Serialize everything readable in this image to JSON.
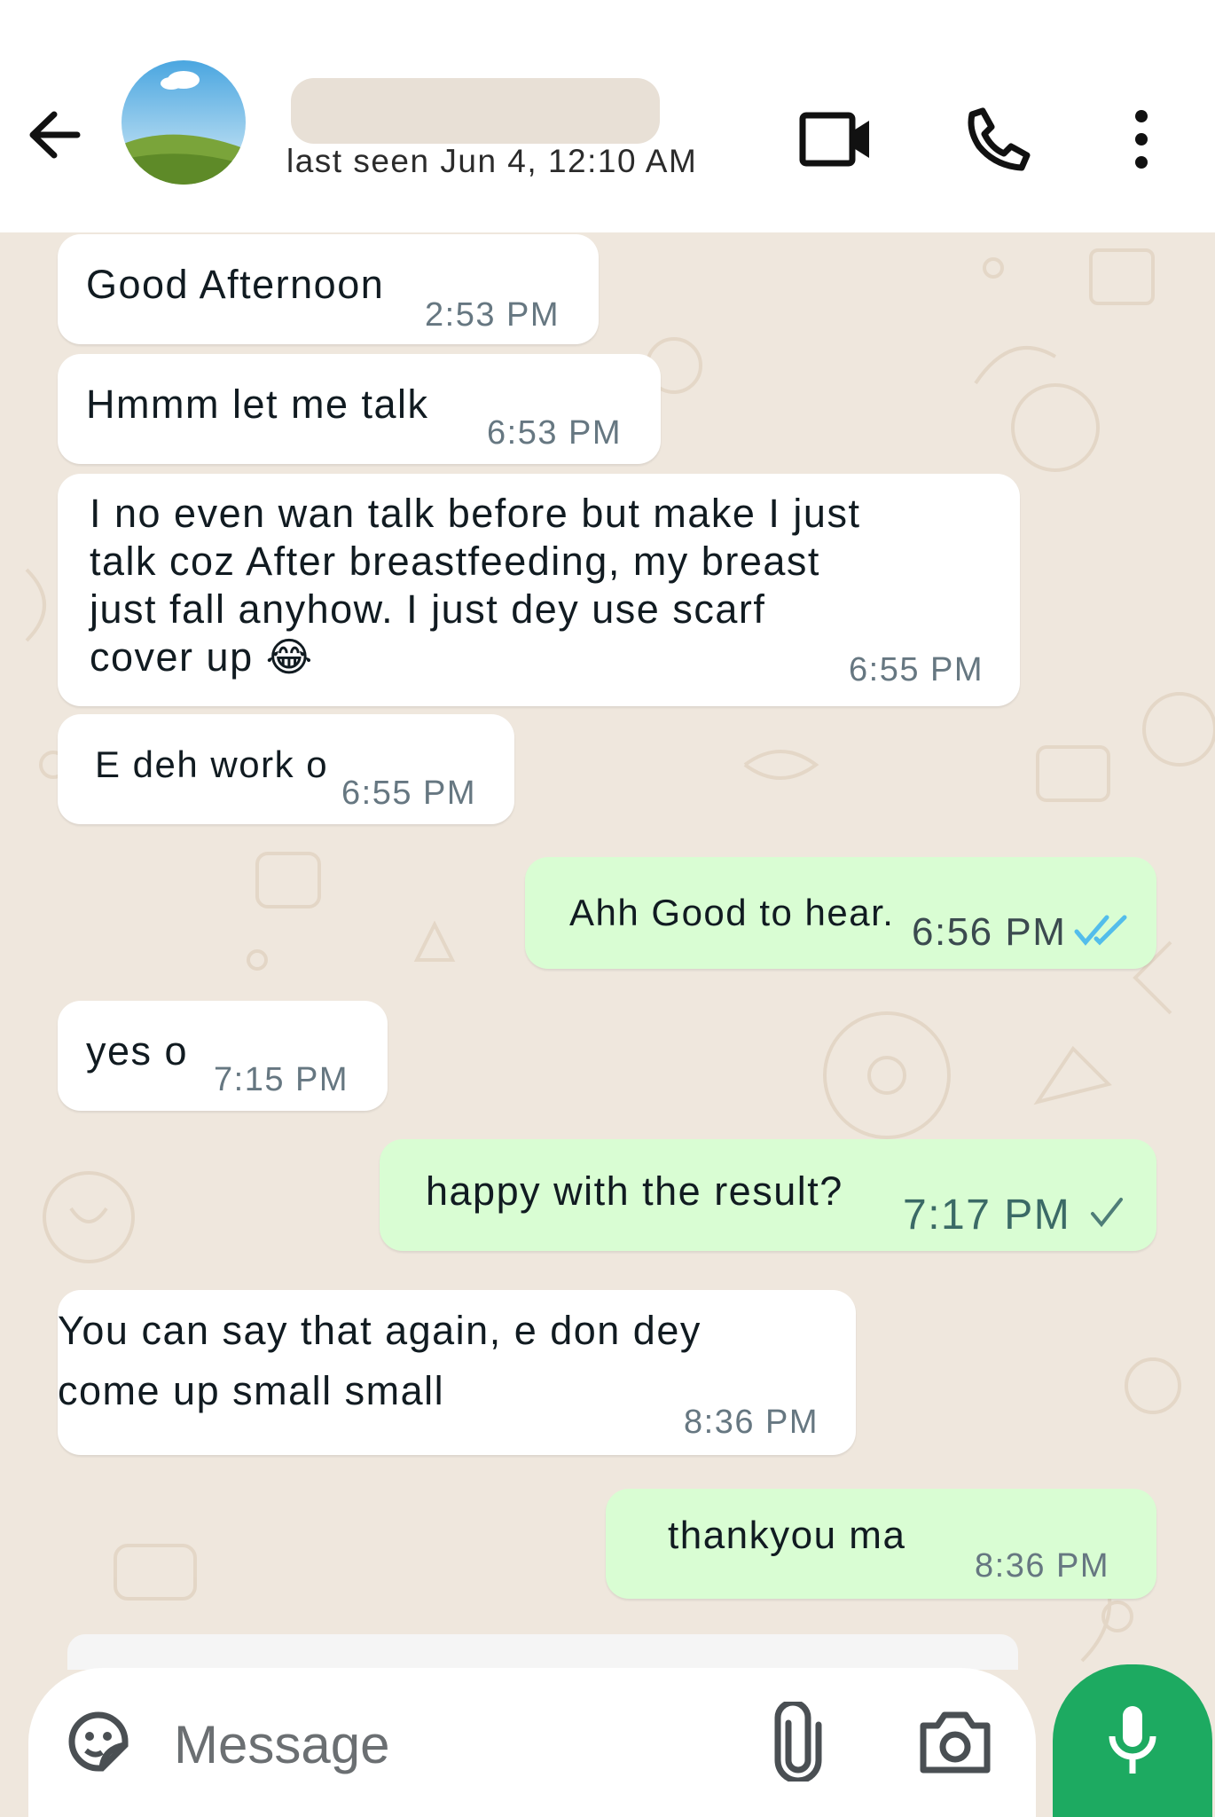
{
  "header": {
    "contact_name": "",
    "last_seen": "last seen Jun 4, 12:10 AM",
    "icons": [
      "back-arrow-icon",
      "video-call-icon",
      "voice-call-icon",
      "more-options-icon"
    ]
  },
  "messages": [
    {
      "direction": "in",
      "text": "Good Afternoon",
      "time": "2:53 PM"
    },
    {
      "direction": "in",
      "text": "Hmmm let me talk",
      "time": "6:53 PM"
    },
    {
      "direction": "in",
      "text": "I no even wan talk before but make I just\ntalk coz After breastfeeding, my breast\njust fall anyhow. I just dey use scarf\ncover up 😂",
      "time": "6:55 PM"
    },
    {
      "direction": "in",
      "text": "E deh work o",
      "time": "6:55 PM"
    },
    {
      "direction": "out",
      "text": "Ahh Good to hear.",
      "time": "6:56 PM",
      "status": "read"
    },
    {
      "direction": "in",
      "text": "yes o",
      "time": "7:15 PM"
    },
    {
      "direction": "out",
      "text": "happy with the result?",
      "time": "7:17 PM",
      "status": "sent"
    },
    {
      "direction": "in",
      "text": "You can say that again, e don dey\ncome up small small",
      "time": "8:36 PM"
    },
    {
      "direction": "out",
      "text": "thankyou ma",
      "time": "8:36 PM"
    }
  ],
  "composer": {
    "placeholder": "Message",
    "icons": [
      "sticker-icon",
      "attach-icon",
      "camera-icon",
      "mic-icon"
    ]
  },
  "colors": {
    "incoming_bubble": "#ffffff",
    "outgoing_bubble": "#d9fdd3",
    "wallpaper": "#efe7dd",
    "read_tick": "#53bdeb",
    "accent_green": "#1daa61"
  }
}
